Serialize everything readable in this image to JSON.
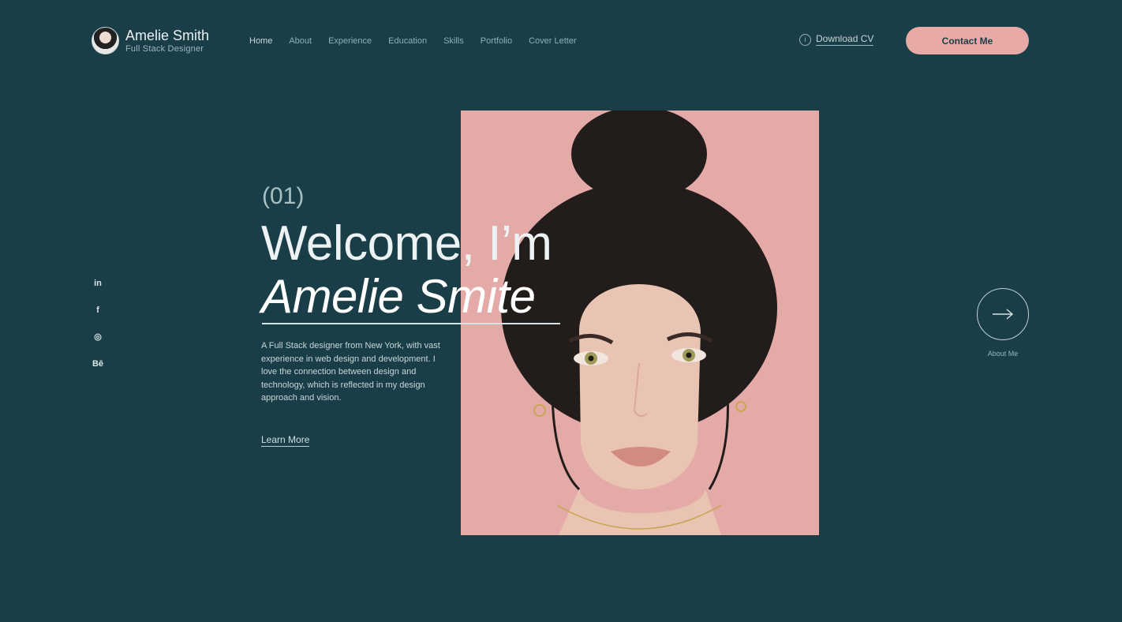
{
  "brand": {
    "name": "Amelie Smith",
    "subtitle": "Full Stack Designer"
  },
  "nav": {
    "items": [
      "Home",
      "About",
      "Experience",
      "Education",
      "Skills",
      "Portfolio",
      "Cover Letter"
    ],
    "active": "Home"
  },
  "header": {
    "download_label": "Download CV",
    "contact_label": "Contact Me"
  },
  "socials": [
    "in",
    "f",
    "◎",
    "Bē"
  ],
  "hero": {
    "number": "(01)",
    "title": "Welcome, I’m",
    "name": "Amelie Smite",
    "description": "A Full Stack designer from New York, with vast experience in web design and development. I love the connection between design and technology, which is reflected in my design approach and vision.",
    "learn_more": "Learn More"
  },
  "next": {
    "label": "About Me"
  },
  "colors": {
    "background": "#1a3e47",
    "accent": "#e7aaa6",
    "photo_bg": "#e4aaa7"
  },
  "icons": {
    "download": "info-circle-icon",
    "next": "arrow-right-icon"
  }
}
